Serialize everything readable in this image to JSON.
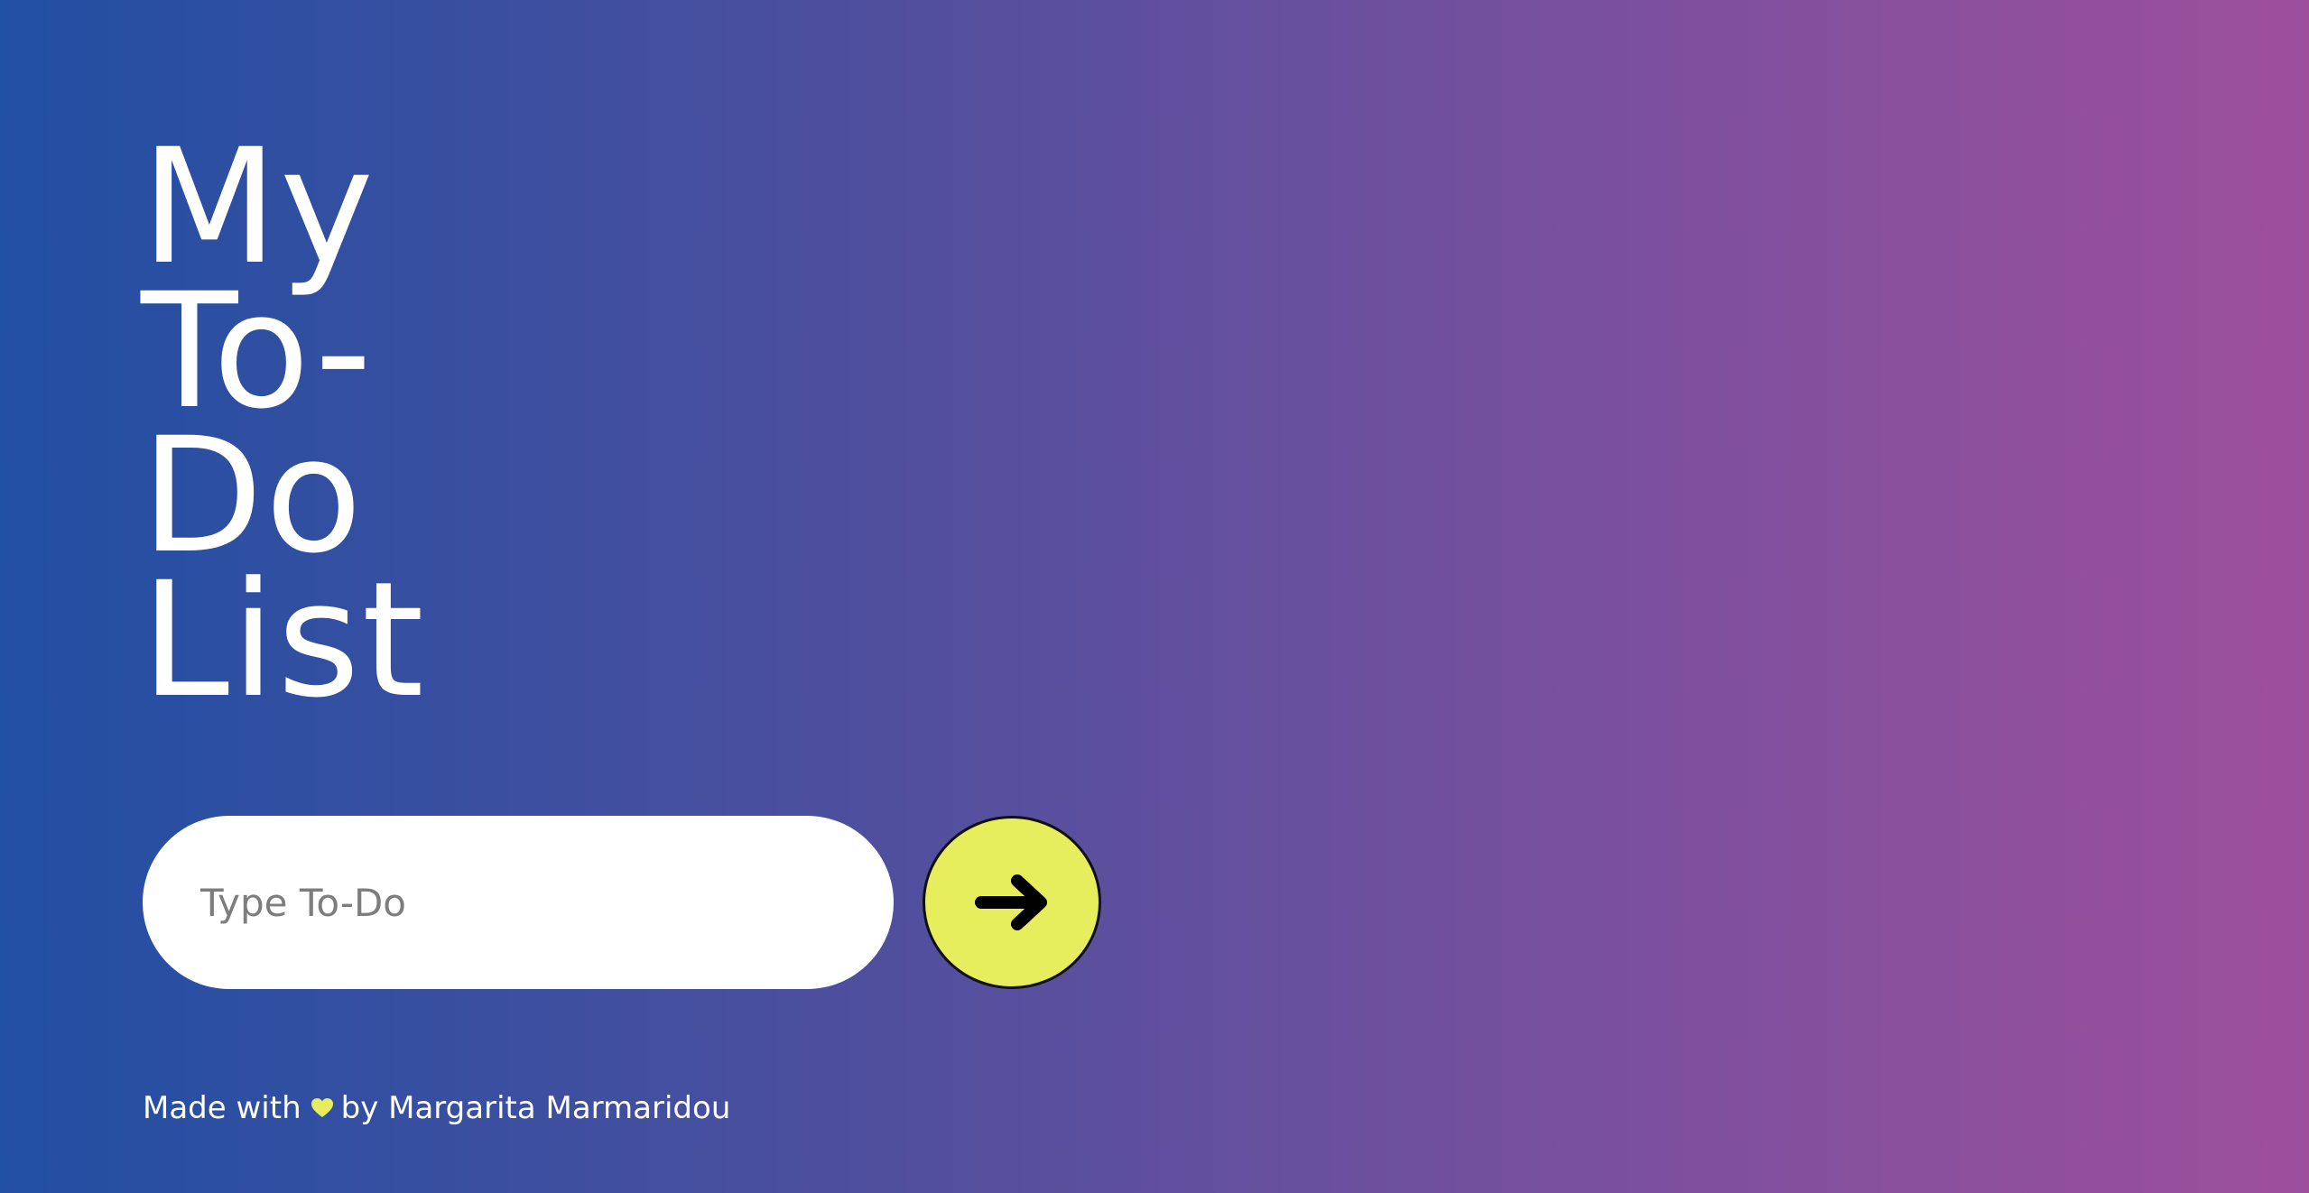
{
  "title": {
    "line1": "My",
    "line2": "To-",
    "line3": "Do",
    "line4": "List"
  },
  "todo_input": {
    "placeholder": "Type To-Do",
    "value": ""
  },
  "add_button": {
    "icon": "arrow-right-icon"
  },
  "footer": {
    "made_with": "Made with",
    "heart_icon": "heart-icon",
    "by_author": "by Margarita Marmaridou"
  },
  "colors": {
    "gradient_start": "#214fa3",
    "gradient_end": "#9d4f9c",
    "accent": "#e6ee5d"
  }
}
